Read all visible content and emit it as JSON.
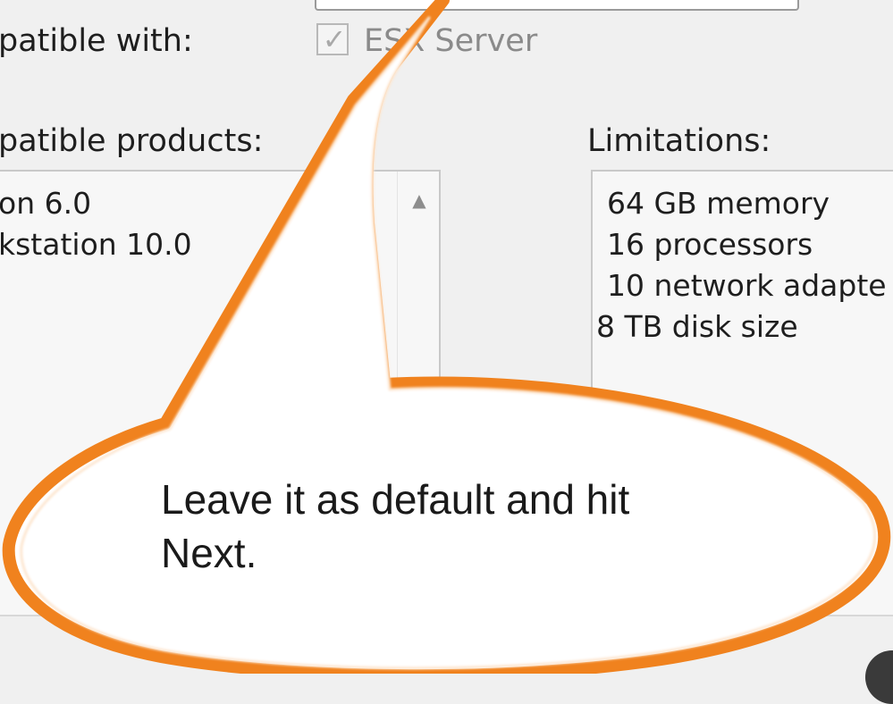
{
  "compat_label": "patible with:",
  "esx_checkbox": {
    "checked": true,
    "label": "ESX Server",
    "check_glyph": "✓"
  },
  "products_label": "patible products:",
  "products": [
    "on 6.0",
    "kstation 10.0"
  ],
  "limitations_label": "Limitations:",
  "limitations": [
    "64 GB memory",
    "16 processors",
    "10 network adapte",
    "8 TB disk size"
  ],
  "callout": {
    "line1": "Leave it as default and hit",
    "line2": "Next.",
    "border_color": "#f0821e",
    "fill_color": "#ffffff"
  },
  "icons": {
    "scroll_up": "▲"
  }
}
